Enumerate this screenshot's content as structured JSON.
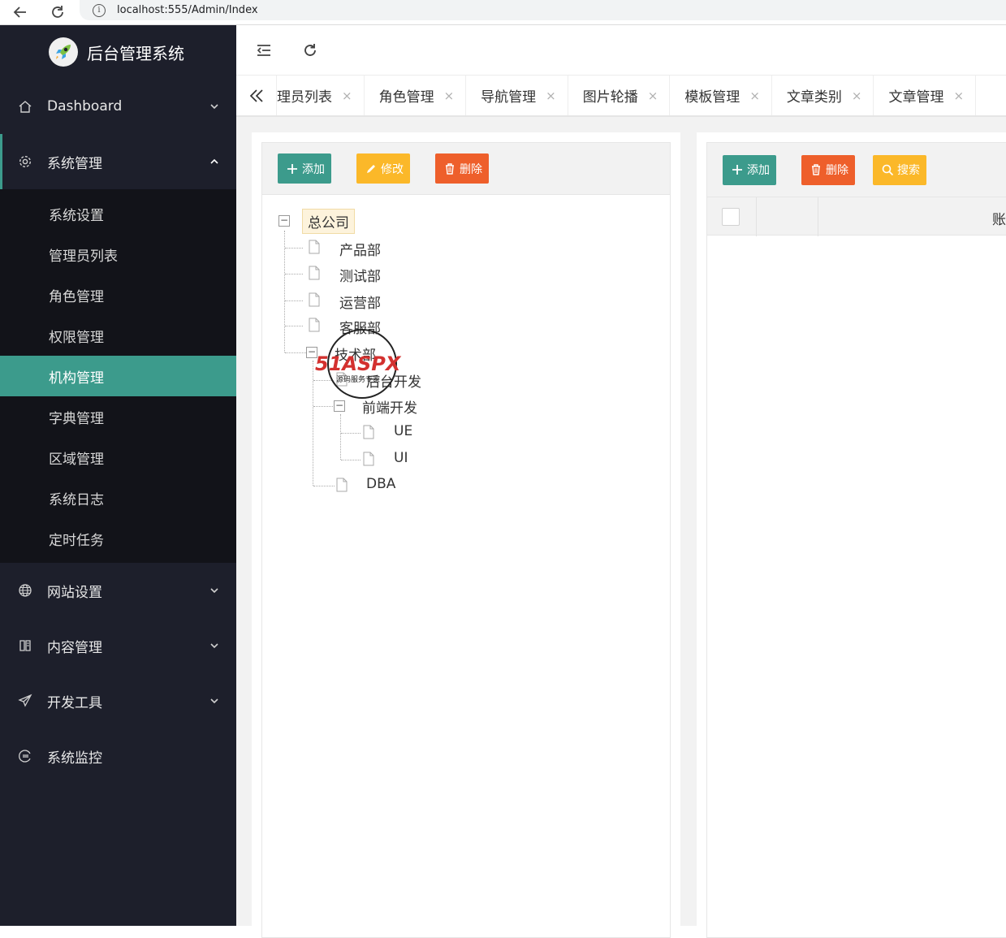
{
  "browser": {
    "url": "localhost:555/Admin/Index"
  },
  "sidebar": {
    "title": "后台管理系统",
    "menu": [
      {
        "label": "Dashboard",
        "icon": "home-icon"
      },
      {
        "label": "系统管理",
        "icon": "gear-icon",
        "open": true
      },
      {
        "label": "网站设置",
        "icon": "globe-icon"
      },
      {
        "label": "内容管理",
        "icon": "book-icon"
      },
      {
        "label": "开发工具",
        "icon": "paper-plane-icon"
      },
      {
        "label": "系统监控",
        "icon": "monitor-icon"
      }
    ],
    "submenu": [
      {
        "label": "系统设置"
      },
      {
        "label": "管理员列表"
      },
      {
        "label": "角色管理"
      },
      {
        "label": "权限管理"
      },
      {
        "label": "机构管理",
        "active": true
      },
      {
        "label": "字典管理"
      },
      {
        "label": "区域管理"
      },
      {
        "label": "系统日志"
      },
      {
        "label": "定时任务"
      }
    ]
  },
  "tabs": [
    {
      "label": "理员列表"
    },
    {
      "label": "角色管理"
    },
    {
      "label": "导航管理"
    },
    {
      "label": "图片轮播"
    },
    {
      "label": "模板管理"
    },
    {
      "label": "文章类别"
    },
    {
      "label": "文章管理"
    }
  ],
  "tab_close_glyph": "×",
  "left_toolbar": {
    "add": "添加",
    "edit": "修改",
    "delete": "删除"
  },
  "tree": {
    "root": "总公司",
    "nodes": [
      "产品部",
      "测试部",
      "运营部",
      "客服部",
      "技术部",
      "后台开发",
      "前端开发",
      "UE",
      "UI",
      "DBA"
    ]
  },
  "right_toolbar": {
    "add": "添加",
    "delete": "删除",
    "search": "搜索"
  },
  "table": {
    "header_partial": "账"
  },
  "watermark": {
    "logo_text": "51ASPX",
    "sub_text": "源码服务专家"
  },
  "colors": {
    "sidebar_bg": "#1d1f2b",
    "accent": "#3c9b8c",
    "warning": "#fbb829",
    "danger": "#ee5f2b"
  }
}
